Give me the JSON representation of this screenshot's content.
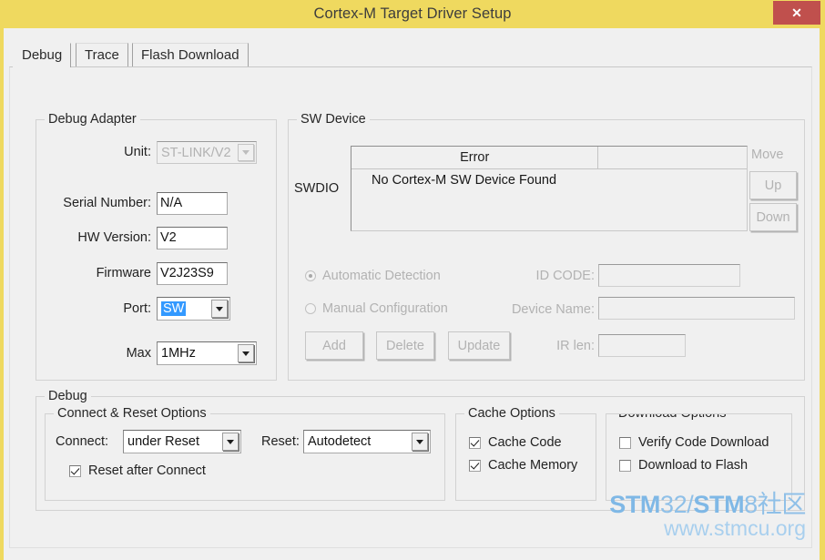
{
  "window": {
    "title": "Cortex-M Target Driver Setup",
    "close_label": "✕",
    "titlebar_color": "#efd95f",
    "close_color": "#c0504d"
  },
  "tabs": [
    {
      "label": "Debug",
      "active": true
    },
    {
      "label": "Trace",
      "active": false
    },
    {
      "label": "Flash Download",
      "active": false
    }
  ],
  "debug_adapter": {
    "title": "Debug Adapter",
    "unit_label": "Unit:",
    "unit_value": "ST-LINK/V2",
    "serial_label": "Serial Number:",
    "serial_value": "N/A",
    "hw_label": "HW Version:",
    "hw_value": "V2",
    "firmware_label": "Firmware",
    "firmware_value": "V2J23S9",
    "port_label": "Port:",
    "port_value": "SW",
    "max_label": "Max",
    "max_value": "1MHz"
  },
  "sw_device": {
    "title": "SW Device",
    "swdio_label": "SWDIO",
    "columns": [
      "Error",
      ""
    ],
    "rows": [
      [
        "No Cortex-M SW Device Found",
        ""
      ]
    ],
    "move_label": "Move",
    "up_label": "Up",
    "down_label": "Down",
    "auto_label": "Automatic Detection",
    "manual_label": "Manual Configuration",
    "idcode_label": "ID CODE:",
    "idcode_value": "",
    "devname_label": "Device Name:",
    "devname_value": "",
    "irlen_label": "IR len:",
    "irlen_value": "",
    "add_label": "Add",
    "delete_label": "Delete",
    "update_label": "Update"
  },
  "debug": {
    "title": "Debug",
    "connect_reset": {
      "title": "Connect & Reset Options",
      "connect_label": "Connect:",
      "connect_value": "under Reset",
      "reset_label": "Reset:",
      "reset_value": "Autodetect",
      "reset_after_connect_label": "Reset after Connect",
      "reset_after_connect_checked": true
    },
    "cache": {
      "title": "Cache Options",
      "cache_code_label": "Cache Code",
      "cache_code_checked": true,
      "cache_memory_label": "Cache Memory",
      "cache_memory_checked": true
    },
    "download": {
      "title": "Download Options",
      "verify_label": "Verify Code Download",
      "verify_checked": false,
      "flash_label": "Download to Flash",
      "flash_checked": false
    }
  },
  "watermark": {
    "line1_a": "STM",
    "line1_b": "32/",
    "line1_c": "STM",
    "line1_d": "8社区",
    "line2": "www.stmcu.org"
  }
}
